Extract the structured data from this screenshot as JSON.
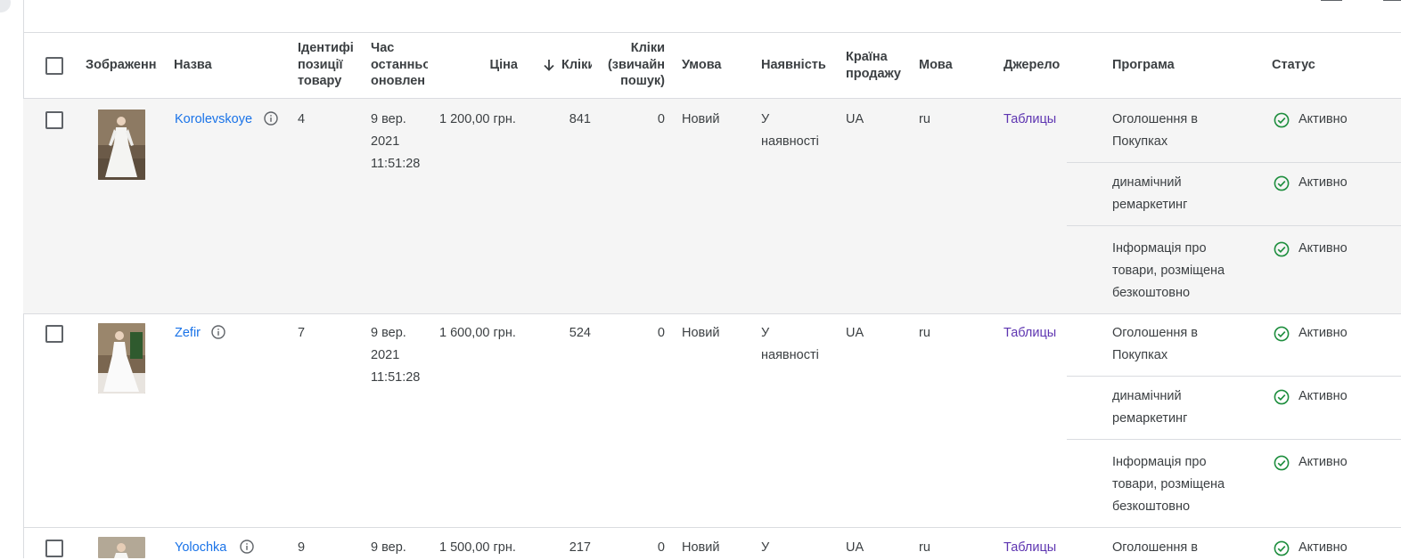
{
  "columns": {
    "image": "Зображення",
    "name": "Назва",
    "item_id": "Ідентифі\nпозиції\nтовару",
    "updated": "Час\nостанньо\nоновлен",
    "price": "Ціна",
    "clicks": "Кліки",
    "clicks_search": "Кліки\n(звичайн\nпошук)",
    "condition": "Умова",
    "availability": "Наявність",
    "country": "Країна\nпродажу",
    "language": "Мова",
    "source": "Джерело",
    "program": "Програма",
    "status": "Статус"
  },
  "colors": {
    "link": "#1a73e8",
    "source_link": "#5e35b1",
    "active": "#1e8e3e",
    "row_shade": "#f5f5f5"
  },
  "rows": [
    {
      "name": "Korolevskoye",
      "item_id": "4",
      "updated": [
        "9 вер.",
        "2021",
        "11:51:28"
      ],
      "price": "1 200,00 грн.",
      "clicks": "841",
      "clicks_search": "0",
      "condition": "Новий",
      "availability": [
        "У",
        "наявності"
      ],
      "country": "UA",
      "language": "ru",
      "source": "Таблицы",
      "programs": [
        {
          "lines": [
            "Оголошення в",
            "Покупках"
          ],
          "status": "Активно"
        },
        {
          "lines": [
            "динамічний",
            "ремаркетинг"
          ],
          "status": "Активно"
        },
        {
          "lines": [
            "Інформація про",
            "товари, розміщена",
            "безкоштовно"
          ],
          "status": "Активно"
        }
      ]
    },
    {
      "name": "Zefir",
      "item_id": "7",
      "updated": [
        "9 вер.",
        "2021",
        "11:51:28"
      ],
      "price": "1 600,00 грн.",
      "clicks": "524",
      "clicks_search": "0",
      "condition": "Новий",
      "availability": [
        "У",
        "наявності"
      ],
      "country": "UA",
      "language": "ru",
      "source": "Таблицы",
      "programs": [
        {
          "lines": [
            "Оголошення в",
            "Покупках"
          ],
          "status": "Активно"
        },
        {
          "lines": [
            "динамічний",
            "ремаркетинг"
          ],
          "status": "Активно"
        },
        {
          "lines": [
            "Інформація про",
            "товари, розміщена",
            "безкоштовно"
          ],
          "status": "Активно"
        }
      ]
    },
    {
      "name": "Yolochka",
      "item_id": "9",
      "updated": [
        "9 вер."
      ],
      "price": "1 500,00 грн.",
      "clicks": "217",
      "clicks_search": "0",
      "condition": "Новий",
      "availability": [
        "У"
      ],
      "country": "UA",
      "language": "ru",
      "source": "Таблицы",
      "programs": [
        {
          "lines": [
            "Оголошення в"
          ],
          "status": "Активно"
        }
      ]
    }
  ]
}
